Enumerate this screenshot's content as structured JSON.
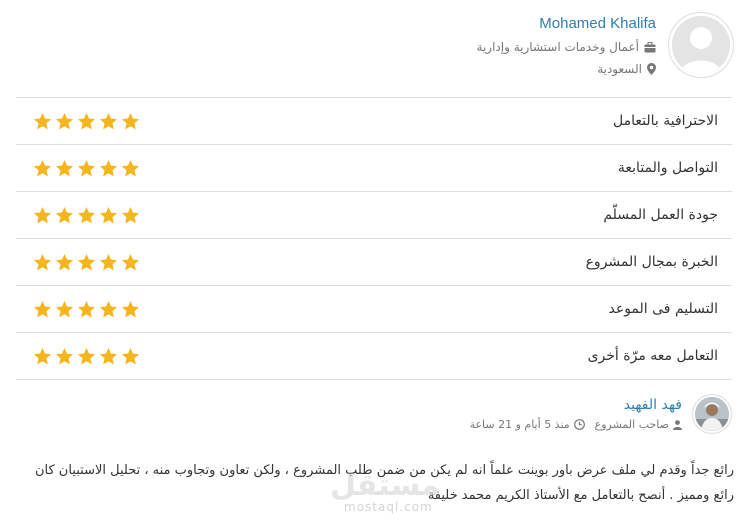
{
  "freelancer": {
    "name": "Mohamed Khalifa",
    "category": "أعمال وخدمات استشارية وإدارية",
    "category_icon": "briefcase-icon",
    "country": "السعودية",
    "country_icon": "map-marker-icon"
  },
  "ratings": {
    "star_color": "#f5b51c",
    "items": [
      {
        "label": "الاحترافية بالتعامل",
        "stars": 5
      },
      {
        "label": "التواصل والمتابعة",
        "stars": 5
      },
      {
        "label": "جودة العمل المسلّم",
        "stars": 5
      },
      {
        "label": "الخبرة بمجال المشروع",
        "stars": 5
      },
      {
        "label": "التسليم فى الموعد",
        "stars": 5
      },
      {
        "label": "التعامل معه مرّة أخرى",
        "stars": 5
      }
    ]
  },
  "review": {
    "author": "فهد الفهيد",
    "role": "صاحب المشروع",
    "time": "منذ 5 أيام و 21 ساعة",
    "text_line1": "رائع جداً وقدم لي ملف عرض باور بوينت علماً انه لم يكن من ضمن طلب المشروع ، ولكن تعاون وتجاوب منه ، تحليل الاستبيان كان",
    "text_line2": "رائع ومميز . أنصح بالتعامل مع الأستاذ الكريم محمد خليفة"
  },
  "watermark": {
    "text": "مستقل",
    "sub": "mostaql.com"
  },
  "colors": {
    "link": "#2d7eb3",
    "divider": "#dddddd",
    "muted": "#777777"
  }
}
